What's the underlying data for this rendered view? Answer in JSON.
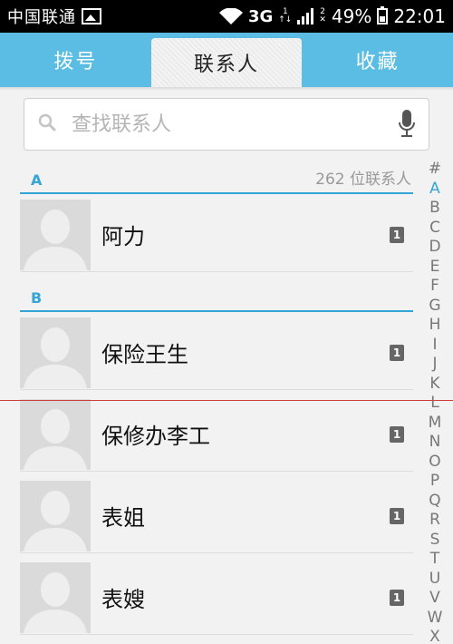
{
  "status_bar": {
    "carrier": "中国联通",
    "network": "3G",
    "battery": "49%",
    "time": "22:01"
  },
  "tabs": [
    {
      "label": "拨号",
      "active": false
    },
    {
      "label": "联系人",
      "active": true
    },
    {
      "label": "收藏",
      "active": false
    }
  ],
  "search": {
    "placeholder": "查找联系人"
  },
  "sections": [
    {
      "letter": "A",
      "count": "262 位联系人"
    },
    {
      "letter": "B",
      "count": ""
    }
  ],
  "contacts": [
    {
      "name": "阿力",
      "sim": "1"
    },
    {
      "name": "保险王生",
      "sim": "1"
    },
    {
      "name": "保修办李工",
      "sim": "1"
    },
    {
      "name": "表姐",
      "sim": "1"
    },
    {
      "name": "表嫂",
      "sim": "1"
    }
  ],
  "index_letters": [
    "#",
    "A",
    "B",
    "C",
    "D",
    "E",
    "F",
    "G",
    "H",
    "I",
    "J",
    "K",
    "L",
    "M",
    "N",
    "O",
    "P",
    "Q",
    "R",
    "S",
    "T",
    "U",
    "V",
    "W",
    "X"
  ],
  "index_active": "A",
  "colors": {
    "accent": "#35a5d6",
    "tabbar": "#5bbde3"
  }
}
